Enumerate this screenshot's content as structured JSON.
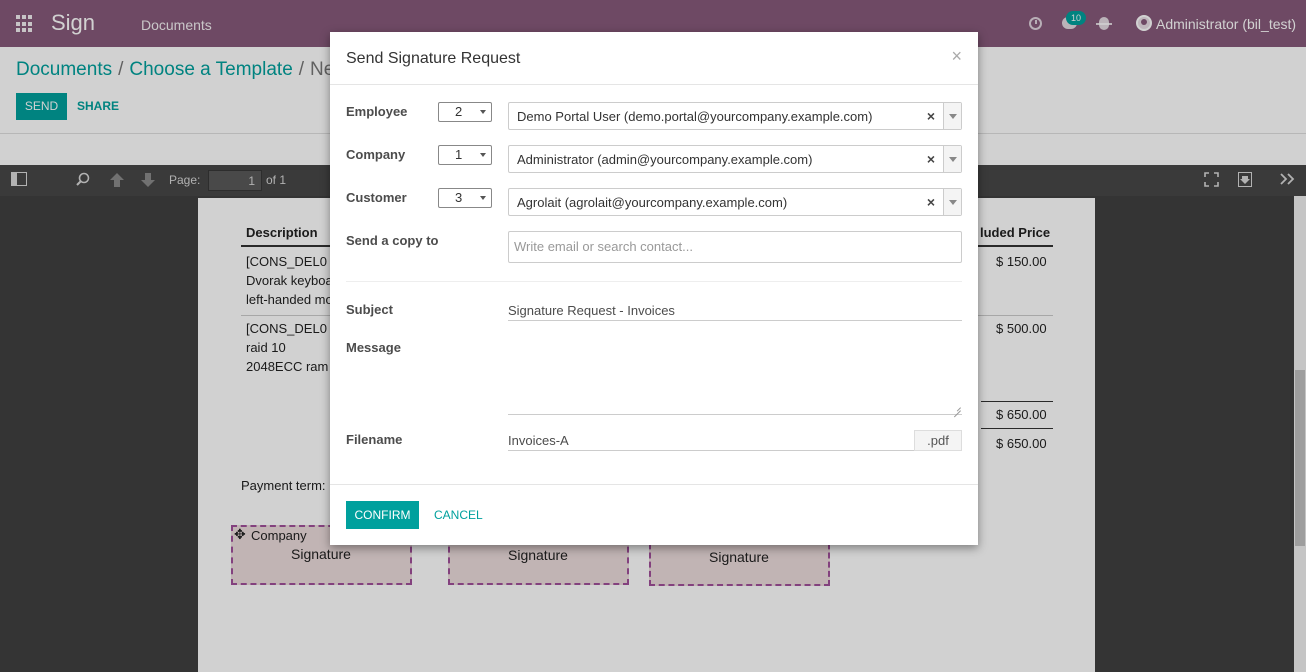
{
  "navbar": {
    "app_title": "Sign",
    "menu_documents": "Documents",
    "chat_count": "10",
    "user": "Administrator (bil_test)"
  },
  "control_panel": {
    "breadcrumb": [
      "Documents",
      "Choose a Template",
      "Ne"
    ],
    "send_label": "SEND",
    "share_label": "SHARE"
  },
  "pdf_toolbar": {
    "page_label": "Page:",
    "page_value": "1",
    "page_of": "of 1"
  },
  "document": {
    "col_description": "Description",
    "col_price": "luded Price",
    "rows": [
      {
        "lines": [
          "[CONS_DEL0",
          "Dvorak keyboa",
          "left-handed mo"
        ],
        "price": "$ 150.00"
      },
      {
        "lines": [
          "[CONS_DEL0",
          "raid 10",
          "2048ECC ram"
        ],
        "price": "$ 500.00"
      }
    ],
    "subtotal": "$ 650.00",
    "total": "$ 650.00",
    "payment_term": "Payment term:",
    "signatures": [
      {
        "role": "Company",
        "label": "Signature"
      },
      {
        "role": "",
        "label": "Signature"
      },
      {
        "role": "",
        "label": "Signature"
      }
    ]
  },
  "modal": {
    "title": "Send Signature Request",
    "close": "×",
    "employee": {
      "label": "Employee",
      "order": "2",
      "value": "Demo Portal User (demo.portal@yourcompany.example.com)"
    },
    "company": {
      "label": "Company",
      "order": "1",
      "value": "Administrator (admin@yourcompany.example.com)"
    },
    "customer": {
      "label": "Customer",
      "order": "3",
      "value": "Agrolait (agrolait@yourcompany.example.com)"
    },
    "copy": {
      "label": "Send a copy to",
      "placeholder": "Write email or search contact..."
    },
    "subject": {
      "label": "Subject",
      "value": "Signature Request - Invoices"
    },
    "message": {
      "label": "Message",
      "value": ""
    },
    "filename": {
      "label": "Filename",
      "value": "Invoices-A",
      "extension": ".pdf"
    },
    "confirm_label": "CONFIRM",
    "cancel_label": "CANCEL",
    "clear_symbol": "×"
  }
}
